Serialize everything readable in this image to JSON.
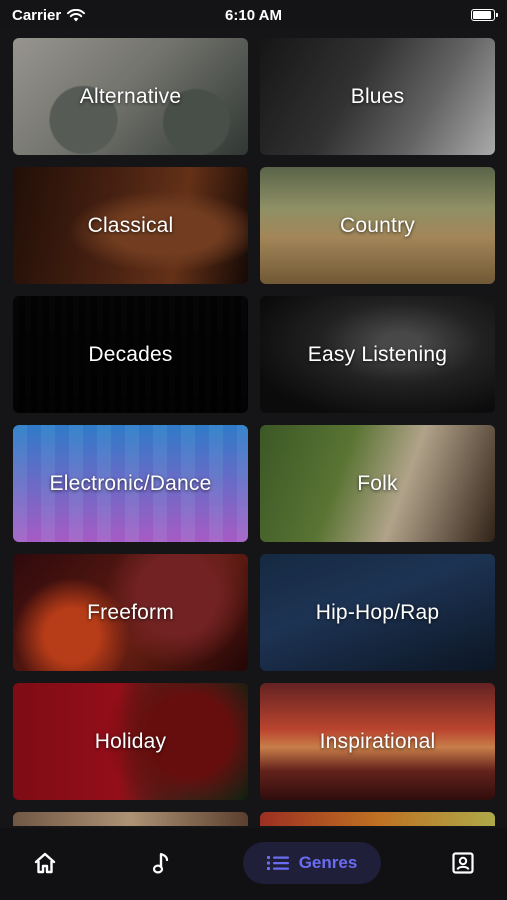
{
  "status": {
    "carrier": "Carrier",
    "time": "6:10 AM"
  },
  "genres": [
    {
      "label": "Alternative",
      "cls": "t-alternative"
    },
    {
      "label": "Blues",
      "cls": "t-blues"
    },
    {
      "label": "Classical",
      "cls": "t-classical"
    },
    {
      "label": "Country",
      "cls": "t-country"
    },
    {
      "label": "Decades",
      "cls": "t-decades"
    },
    {
      "label": "Easy Listening",
      "cls": "t-easy"
    },
    {
      "label": "Electronic/Dance",
      "cls": "t-electronic"
    },
    {
      "label": "Folk",
      "cls": "t-folk"
    },
    {
      "label": "Freeform",
      "cls": "t-freeform"
    },
    {
      "label": "Hip-Hop/Rap",
      "cls": "t-hiphop"
    },
    {
      "label": "Holiday",
      "cls": "t-holiday"
    },
    {
      "label": "Inspirational",
      "cls": "t-inspirational"
    }
  ],
  "tabbar": {
    "genres_label": "Genres",
    "active_color": "#6a6cf2",
    "icons": [
      "home-icon",
      "music-note-icon",
      "list-icon",
      "profile-icon"
    ]
  }
}
